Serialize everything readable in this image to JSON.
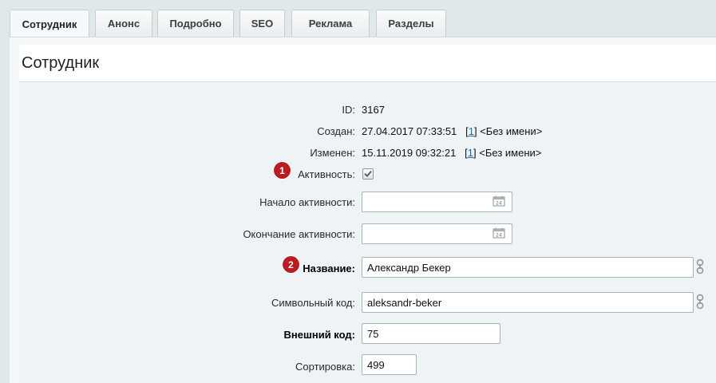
{
  "tabs": [
    {
      "label": "Сотрудник",
      "active": true
    },
    {
      "label": "Анонс",
      "active": false
    },
    {
      "label": "Подробно",
      "active": false
    },
    {
      "label": "SEO",
      "active": false
    },
    {
      "label": "Реклама",
      "active": false
    },
    {
      "label": "Разделы",
      "active": false
    }
  ],
  "section_title": "Сотрудник",
  "fields": {
    "id": {
      "label": "ID:",
      "value": "3167"
    },
    "created": {
      "label": "Создан:",
      "date": "27.04.2017 07:33:51",
      "user_link": "1",
      "user_name": "<Без имени>"
    },
    "modified": {
      "label": "Изменен:",
      "date": "15.11.2019 09:32:21",
      "user_link": "1",
      "user_name": "<Без имени>"
    },
    "active": {
      "label": "Активность:",
      "checked": true
    },
    "active_from": {
      "label": "Начало активности:",
      "value": ""
    },
    "active_to": {
      "label": "Окончание активности:",
      "value": ""
    },
    "name": {
      "label": "Название:",
      "value": "Александр Бекер"
    },
    "code": {
      "label": "Символьный код:",
      "value": "aleksandr-beker"
    },
    "external_code": {
      "label": "Внешний код:",
      "value": "75"
    },
    "sort": {
      "label": "Сортировка:",
      "value": "499"
    }
  },
  "badges": {
    "b1": "1",
    "b2": "2"
  },
  "colors": {
    "badge": "#b81e21",
    "link": "#2067b0"
  }
}
